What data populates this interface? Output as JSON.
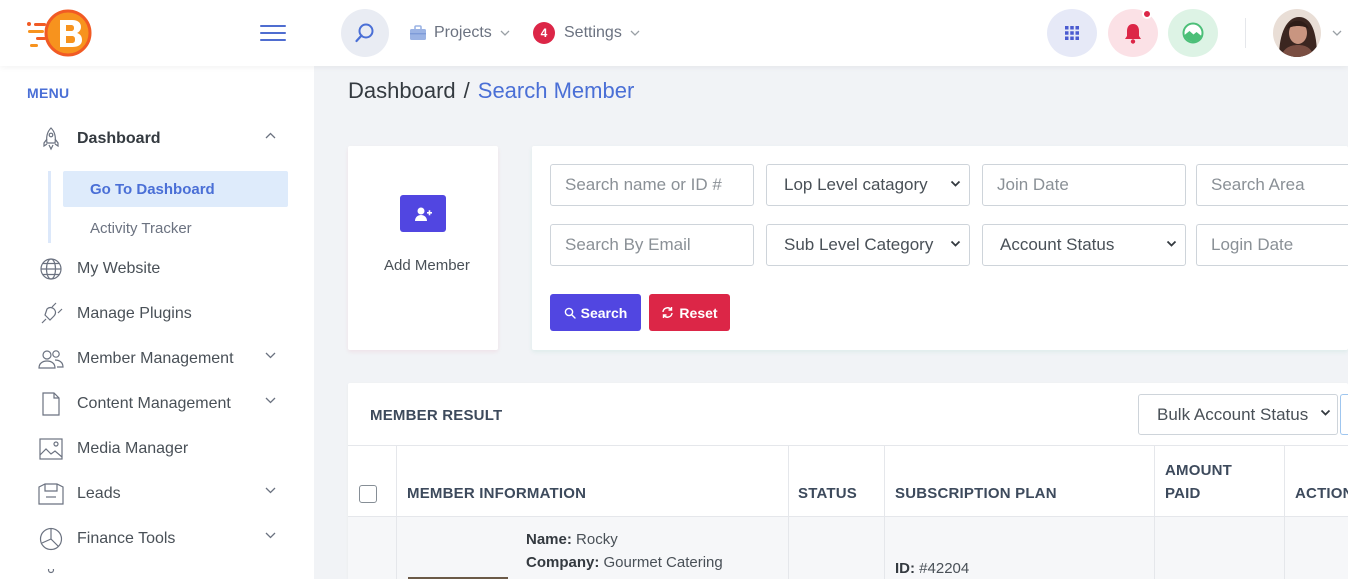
{
  "header": {
    "nav": [
      {
        "label": "Projects"
      },
      {
        "label": "Settings",
        "badge": "4"
      }
    ]
  },
  "sidebar": {
    "menu_title": "MENU",
    "items": [
      {
        "label": "Dashboard",
        "icon": "rocket-icon",
        "expanded": true
      },
      {
        "label": "My Website",
        "icon": "globe-icon"
      },
      {
        "label": "Manage Plugins",
        "icon": "plugin-icon"
      },
      {
        "label": "Member Management",
        "icon": "users-icon"
      },
      {
        "label": "Content Management",
        "icon": "document-icon"
      },
      {
        "label": "Media Manager",
        "icon": "image-icon"
      },
      {
        "label": "Leads",
        "icon": "leads-icon"
      },
      {
        "label": "Finance Tools",
        "icon": "pie-chart-icon"
      }
    ],
    "sub_items": [
      {
        "label": "Go To Dashboard",
        "active": true
      },
      {
        "label": "Activity Tracker"
      }
    ]
  },
  "breadcrumb": {
    "root": "Dashboard",
    "separator": "/",
    "current": "Search Member"
  },
  "add_member": {
    "label": "Add Member"
  },
  "filters": {
    "search_name_placeholder": "Search name or ID #",
    "top_level_category": "Lop Level catagory",
    "join_date_placeholder": "Join Date",
    "search_area_placeholder": "Search Area",
    "search_email_placeholder": "Search By Email",
    "sub_level_category": "Sub Level Category",
    "account_status": "Account Status",
    "login_date_placeholder": "Login Date",
    "search_button": "Search",
    "reset_button": "Reset"
  },
  "results": {
    "title": "MEMBER RESULT",
    "bulk_status": "Bulk Account Status",
    "columns": {
      "member_information": "MEMBER INFORMATION",
      "status": "STATUS",
      "subscription_plan": "SUBSCRIPTION PLAN",
      "amount_paid_line1": "AMOUNT",
      "amount_paid_line2": "PAID",
      "action": "ACTION"
    },
    "rows": [
      {
        "name_label": "Name:",
        "name": "Rocky",
        "company_label": "Company:",
        "company": "Gourmet Catering",
        "id_label": "ID:",
        "id": "#42204"
      }
    ]
  },
  "colors": {
    "primary": "#5146e1",
    "danger": "#dc2647",
    "accent": "#4a6fd6",
    "success": "#4cbf78"
  }
}
